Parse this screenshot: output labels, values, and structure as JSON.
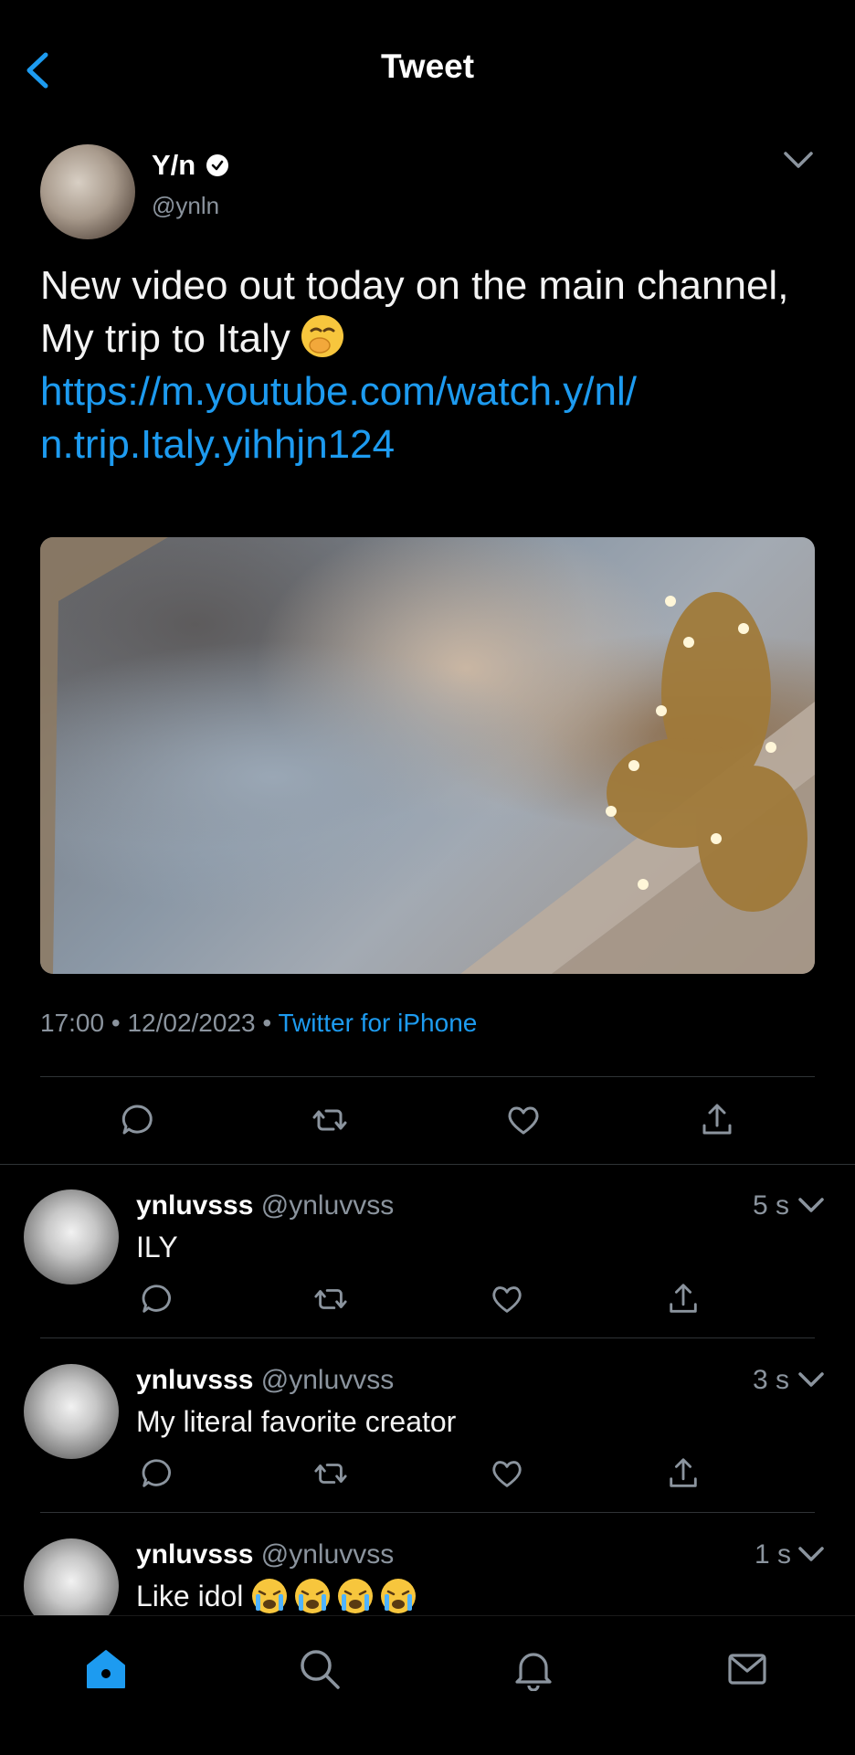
{
  "header": {
    "title": "Tweet"
  },
  "tweet": {
    "author_name": "Y/n",
    "author_handle": "@ynln",
    "text": "New video out today on the main channel, My trip to Italy",
    "link_line1": "https://m.youtube.com/watch.y/nl/",
    "link_line2": "n.trip.Italy.yihhjn124",
    "time": "17:00",
    "date": "12/02/2023",
    "separator": "•",
    "source": "Twitter for iPhone"
  },
  "replies": [
    {
      "name": "ynluvsss",
      "handle": "@ynluvvss",
      "time": "5 s",
      "text": "ILY"
    },
    {
      "name": "ynluvsss",
      "handle": "@ynluvvss",
      "time": "3 s",
      "text": "My literal favorite creator"
    },
    {
      "name": "ynluvsss",
      "handle": "@ynluvvss",
      "time": "1 s",
      "text": "Like idol"
    }
  ],
  "colors": {
    "accent": "#1d9bf0",
    "background": "#000000",
    "muted": "#8b949e"
  },
  "icons": [
    "back-icon",
    "verified-icon",
    "chevron-down-icon",
    "reply-icon",
    "retweet-icon",
    "like-icon",
    "share-icon",
    "home-icon",
    "search-icon",
    "bell-icon",
    "mail-icon"
  ]
}
